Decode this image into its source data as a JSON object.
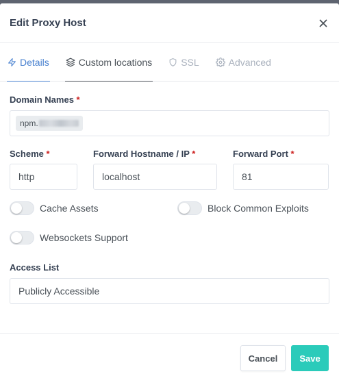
{
  "modal": {
    "title": "Edit Proxy Host"
  },
  "tabs": [
    {
      "label": "Details",
      "icon": "bolt-icon"
    },
    {
      "label": "Custom locations",
      "icon": "layers-icon"
    },
    {
      "label": "SSL",
      "icon": "shield-icon"
    },
    {
      "label": "Advanced",
      "icon": "gear-icon"
    }
  ],
  "form": {
    "domain_names": {
      "label": "Domain Names",
      "required": "*",
      "chip": "npm."
    },
    "scheme": {
      "label": "Scheme",
      "required": "*",
      "value": "http"
    },
    "forward_host": {
      "label": "Forward Hostname / IP",
      "required": "*",
      "value": "localhost"
    },
    "forward_port": {
      "label": "Forward Port",
      "required": "*",
      "value": "81"
    },
    "cache_assets": {
      "label": "Cache Assets",
      "checked": false
    },
    "block_exploits": {
      "label": "Block Common Exploits",
      "checked": false
    },
    "websockets": {
      "label": "Websockets Support",
      "checked": false
    },
    "access_list": {
      "label": "Access List",
      "value": "Publicly Accessible"
    }
  },
  "footer": {
    "cancel_label": "Cancel",
    "save_label": "Save"
  },
  "colors": {
    "accent": "#467fcf",
    "save": "#2bcbba",
    "required": "#cd201f"
  }
}
